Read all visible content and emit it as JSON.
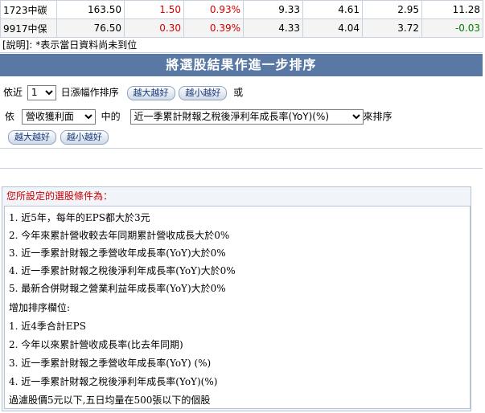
{
  "stocks": [
    {
      "code_name": "1723中碳",
      "price": "163.50",
      "change": "1.50",
      "change_pct": "0.93%",
      "c5": "9.33",
      "c6": "4.61",
      "c7": "2.95",
      "c8": "11.28",
      "trend": "up"
    },
    {
      "code_name": "9917中保",
      "price": "76.50",
      "change": "0.30",
      "change_pct": "0.39%",
      "c5": "4.33",
      "c6": "4.04",
      "c7": "3.72",
      "c8": "-0.03",
      "trend": "up"
    }
  ],
  "note": "[說明]: *表示當日資料尚未到位",
  "sort_section": {
    "title": "將選股結果作進一步排序",
    "row1": {
      "prefix": "依近",
      "days_value": "1",
      "suffix": "日漲幅作排序",
      "btn_high": "越大越好",
      "btn_low": "越小越好",
      "or_text": "或"
    },
    "row2": {
      "prefix": "依",
      "category_value": "營收獲利面",
      "middle": "中的",
      "field_value": "近一季累計財報之稅後淨利年成長率(YoY)(%)",
      "suffix": "來排序"
    },
    "row3": {
      "btn_high": "越大越好",
      "btn_low": "越小越好"
    }
  },
  "conditions": {
    "title": "您所設定的選股條件為：",
    "lines": [
      "1. 近5年，每年的EPS都大於3元",
      "2. 今年來累計營收較去年同期累計營收成長大於0%",
      "3. 近一季累計財報之季營收年成長率(YoY)大於0%",
      "4. 近一季累計財報之稅後淨利年成長率(YoY)大於0%",
      "5. 最新合併財報之營業利益年成長率(YoY)大於0%",
      "增加排序欄位:",
      "1. 近4季合計EPS",
      "2. 今年以來累計營收成長率(比去年同期)",
      "3. 近一季累計財報之季營收年成長率(YoY) (%)",
      "4. 近一季累計財報之稅後淨利年成長率(YoY)(%)",
      "過濾股價5元以下,五日均量在500張以下的個股"
    ]
  },
  "colors": {
    "header_bg": "#5a78a4",
    "up": "#d40000",
    "down": "#008000",
    "cond_title": "#cc0000"
  }
}
